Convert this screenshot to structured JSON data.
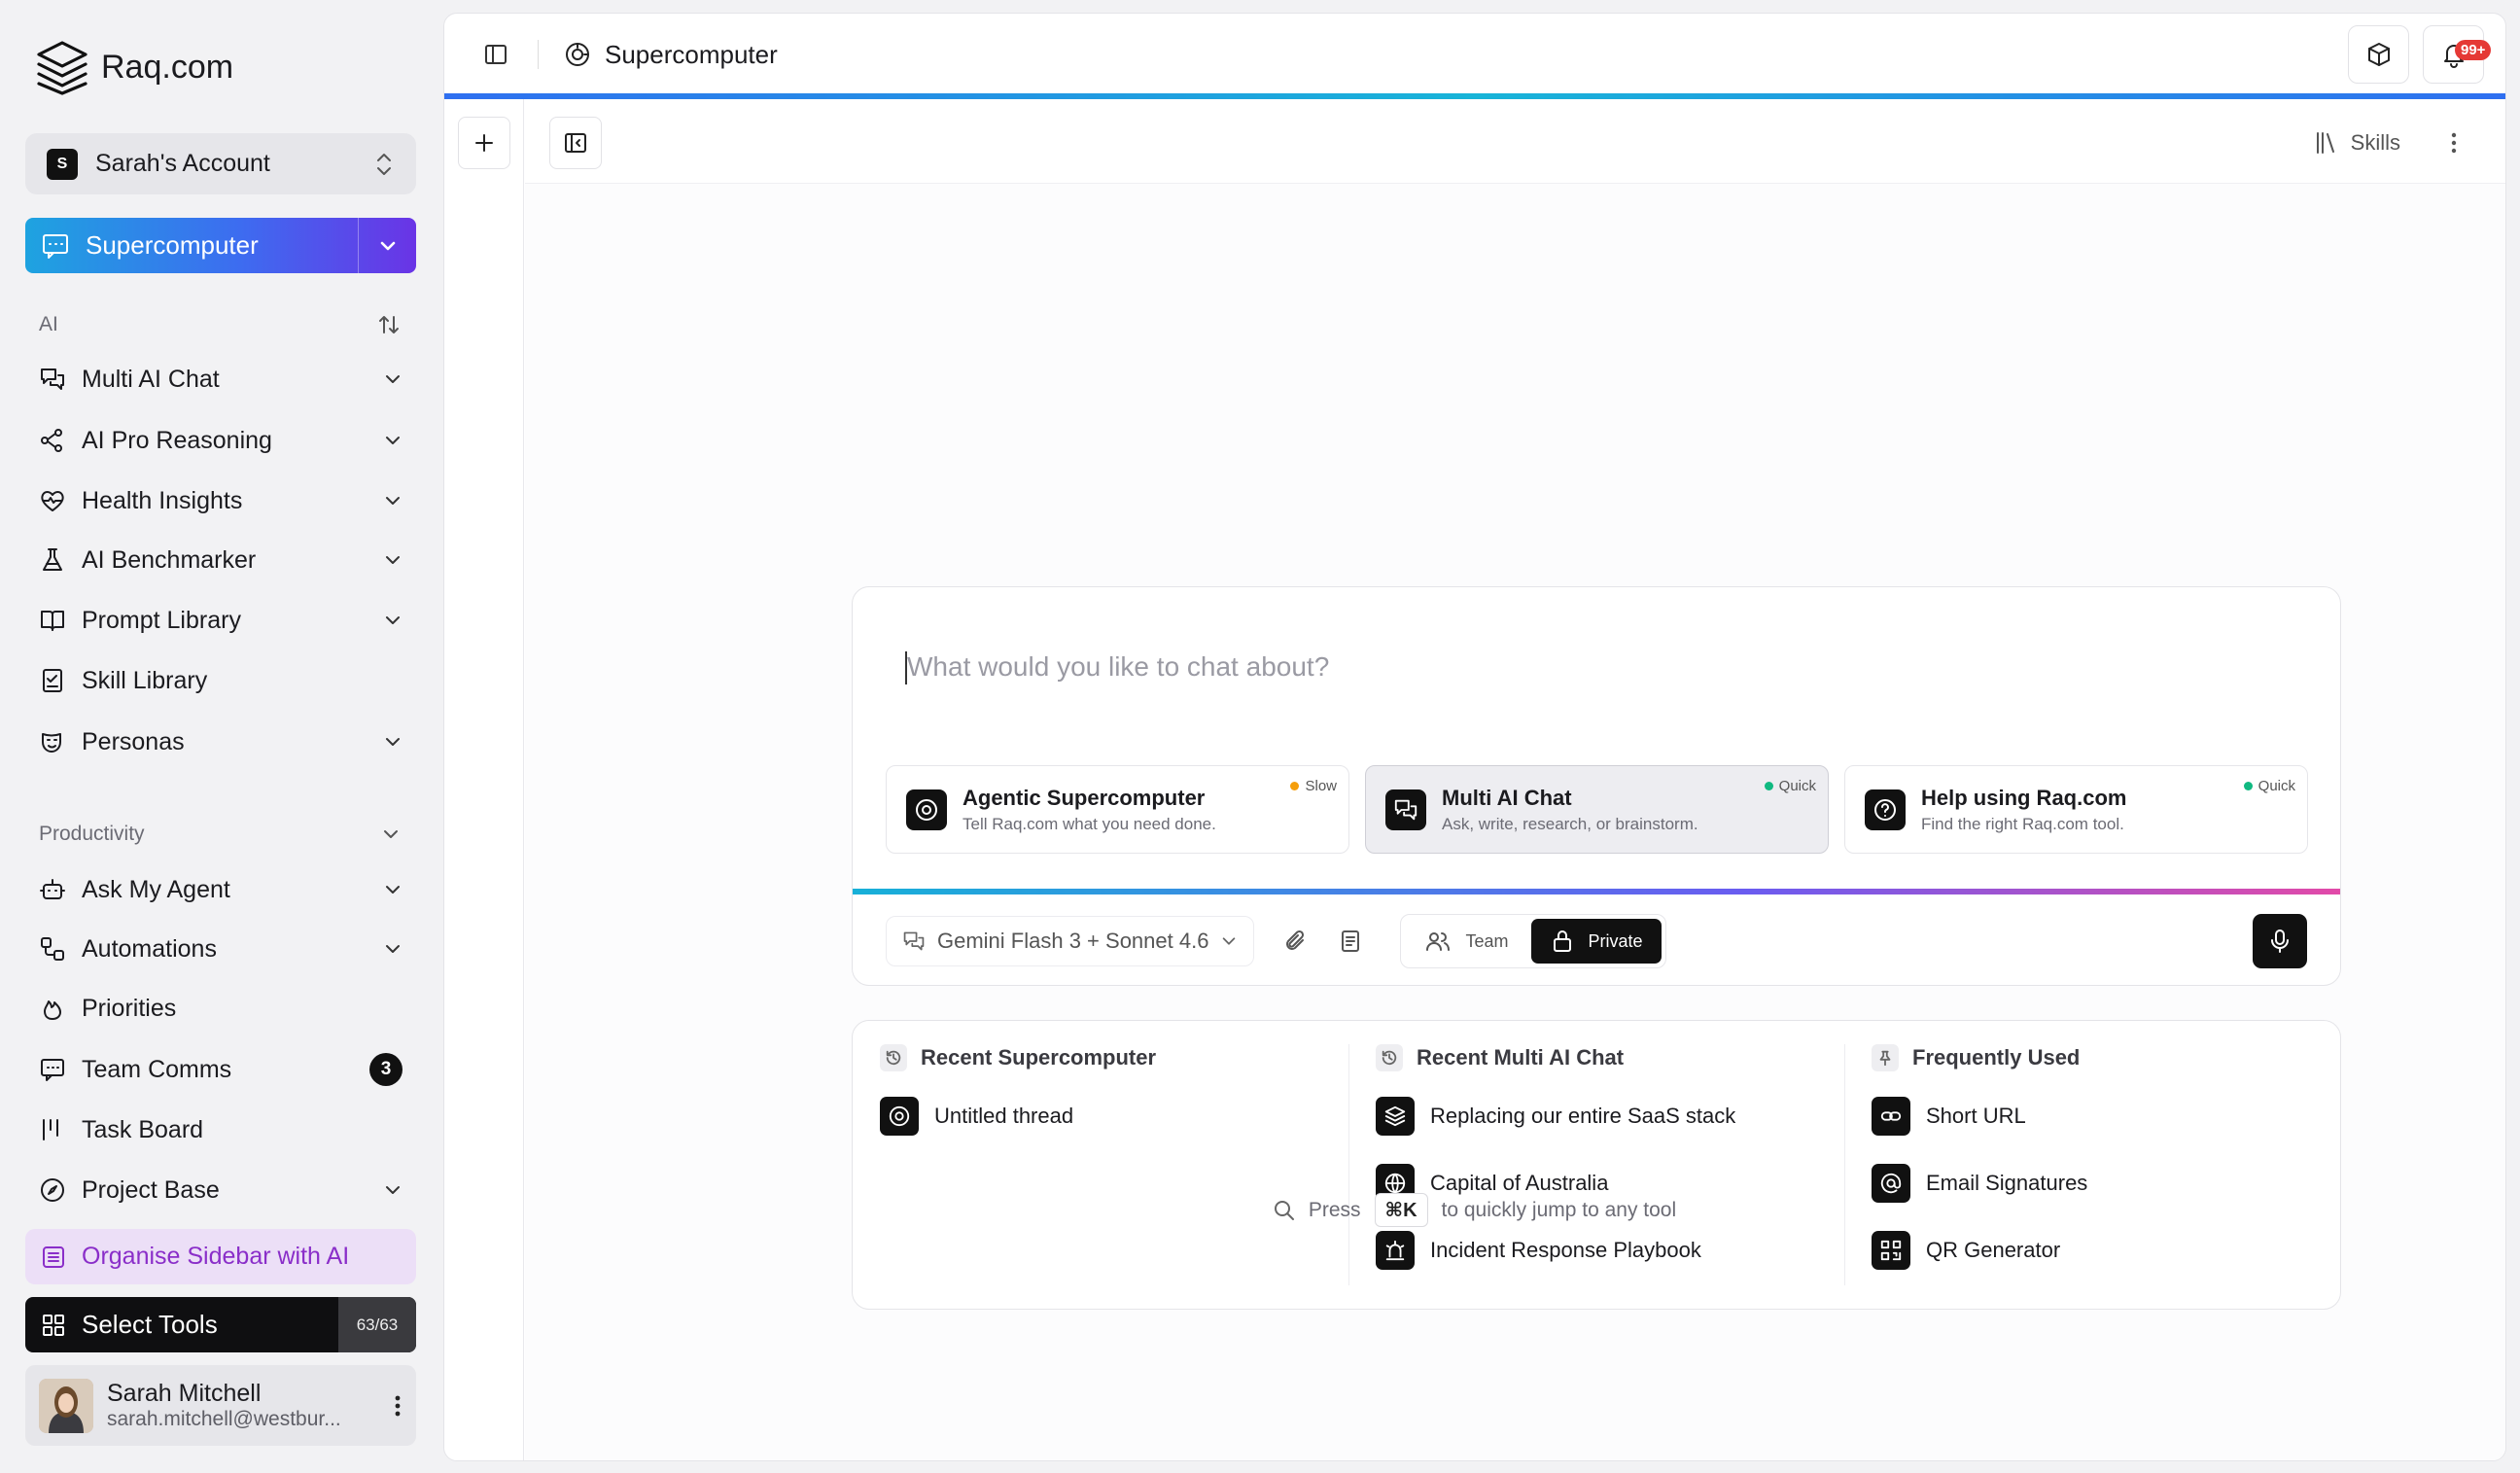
{
  "brand": {
    "name": "Raq.com"
  },
  "account": {
    "badge": "S",
    "name": "Sarah's Account"
  },
  "primary": {
    "label": "Supercomputer"
  },
  "sections": {
    "ai": "AI",
    "productivity": "Productivity"
  },
  "ai_items": [
    {
      "label": "Multi AI Chat",
      "icon": "chat-icon"
    },
    {
      "label": "AI Pro Reasoning",
      "icon": "network-icon"
    },
    {
      "label": "Health Insights",
      "icon": "heart-pulse-icon"
    },
    {
      "label": "AI Benchmarker",
      "icon": "flask-icon"
    },
    {
      "label": "Prompt Library",
      "icon": "book-icon"
    },
    {
      "label": "Skill Library",
      "icon": "checklist-icon"
    },
    {
      "label": "Personas",
      "icon": "mask-icon"
    }
  ],
  "prod_items": [
    {
      "label": "Ask My Agent",
      "icon": "bot-icon"
    },
    {
      "label": "Automations",
      "icon": "workflow-icon"
    },
    {
      "label": "Priorities",
      "icon": "flame-icon"
    },
    {
      "label": "Team Comms",
      "icon": "message-icon",
      "count": "3"
    },
    {
      "label": "Task Board",
      "icon": "kanban-icon"
    },
    {
      "label": "Project Base",
      "icon": "compass-icon"
    }
  ],
  "organise": {
    "label": "Organise Sidebar with AI"
  },
  "select_tools": {
    "label": "Select Tools",
    "count": "63/63"
  },
  "user": {
    "name": "Sarah Mitchell",
    "email": "sarah.mitchell@westbur..."
  },
  "header": {
    "title": "Supercomputer",
    "notifications": "99+"
  },
  "toolbar": {
    "skills": "Skills"
  },
  "chat": {
    "placeholder": "What would you like to chat about?",
    "modes": [
      {
        "title": "Agentic Supercomputer",
        "desc": "Tell Raq.com what you need done.",
        "speed": "Slow",
        "speed_color": "#f59e0b"
      },
      {
        "title": "Multi AI Chat",
        "desc": "Ask, write, research, or brainstorm.",
        "speed": "Quick",
        "speed_color": "#10b981"
      },
      {
        "title": "Help using Raq.com",
        "desc": "Find the right Raq.com tool.",
        "speed": "Quick",
        "speed_color": "#10b981"
      }
    ],
    "model": "Gemini Flash 3 + Sonnet 4.6",
    "team": "Team",
    "private": "Private"
  },
  "recent": {
    "supercomputer": {
      "title": "Recent Supercomputer",
      "items": [
        "Untitled thread"
      ]
    },
    "multi": {
      "title": "Recent Multi AI Chat",
      "items": [
        "Replacing our entire SaaS stack",
        "Capital of Australia",
        "Incident Response Playbook"
      ]
    },
    "frequent": {
      "title": "Frequently Used",
      "items": [
        "Short URL",
        "Email Signatures",
        "QR Generator"
      ]
    }
  },
  "hint": {
    "press": "Press",
    "key": "⌘K",
    "rest": "to quickly jump to any tool"
  }
}
